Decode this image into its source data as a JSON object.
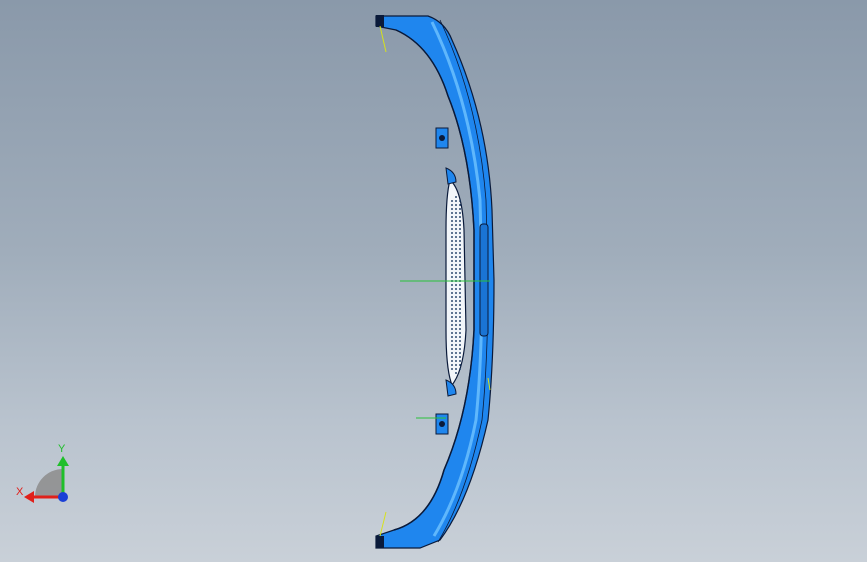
{
  "triad": {
    "x_label": "X",
    "y_label": "Y",
    "x_color": "#e0201a",
    "y_color": "#1fbf2a",
    "z_color": "#1a3fd6"
  },
  "part": {
    "body_color": "#1f86ee",
    "edge_color": "#0a1a3a",
    "highlight_color": "#6fc3ff",
    "reference_line_color": "#d7e21a",
    "center_line_color": "#29c23a"
  }
}
